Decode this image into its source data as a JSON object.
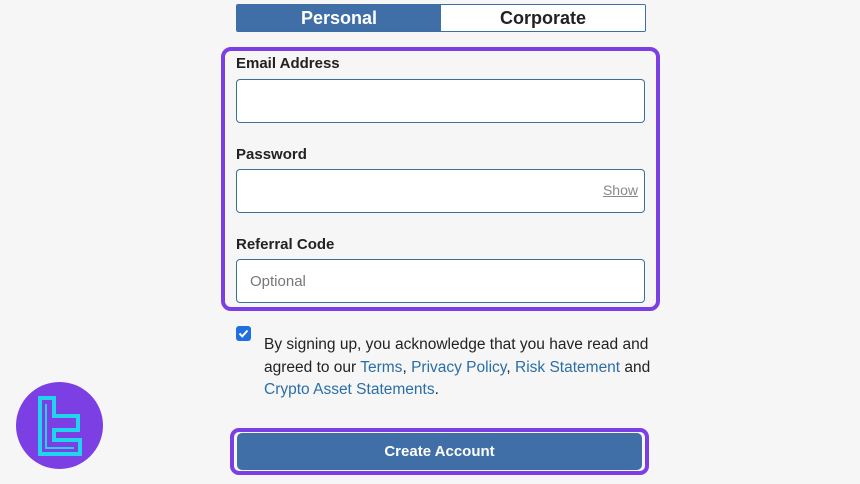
{
  "tabs": [
    {
      "label": "Personal",
      "active": true
    },
    {
      "label": "Corporate",
      "active": false
    }
  ],
  "form": {
    "email_label": "Email Address",
    "email_value": "",
    "password_label": "Password",
    "password_value": "",
    "password_toggle": "Show",
    "referral_label": "Referral Code",
    "referral_value": "",
    "referral_placeholder": "Optional"
  },
  "consent": {
    "checked": true,
    "text_before": "By signing up, you acknowledge that you have read and agreed to our ",
    "terms": "Terms",
    "sep1": ", ",
    "privacy": "Privacy Policy",
    "sep2": ",",
    "risk": "Risk Statement",
    "and_text": " and ",
    "crypto": "Crypto Asset Statements",
    "end": "."
  },
  "submit_label": "Create Account",
  "colors": {
    "primary": "#3f6fa6",
    "highlight": "#7b3fe4",
    "link": "#2b6ea6",
    "logo_accent": "#22d3ee"
  }
}
